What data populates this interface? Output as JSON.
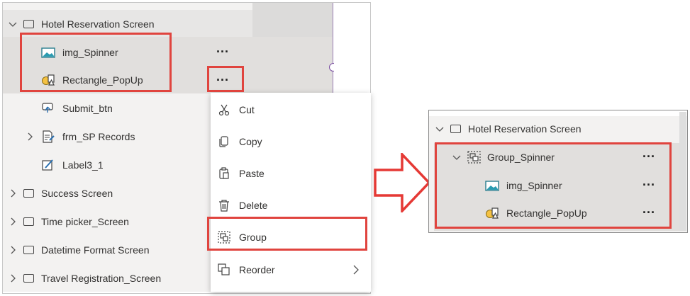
{
  "tree": {
    "screen_title": "Hotel Reservation Screen",
    "children": [
      "img_Spinner",
      "Rectangle_PopUp",
      "Submit_btn",
      "frm_SP Records",
      "Label3_1"
    ],
    "other_screens": [
      "Success Screen",
      "Time picker_Screen",
      "Datetime Format Screen",
      "Travel Registration_Screen"
    ],
    "more": "..."
  },
  "context_menu": {
    "items": [
      "Cut",
      "Copy",
      "Paste",
      "Delete",
      "Group",
      "Reorder"
    ]
  },
  "result": {
    "screen_title": "Hotel Reservation Screen",
    "group_name": "Group_Spinner",
    "children": [
      "img_Spinner",
      "Rectangle_PopUp"
    ],
    "more": "..."
  },
  "colors": {
    "highlight": "#e0443e",
    "arrow": "#e53935",
    "panel_bg": "#f3f2f1",
    "selected_bg": "#e1dfdd"
  },
  "icons": {
    "expand": "chevron-down-icon",
    "collapse": "chevron-right-icon",
    "screen": "screen-icon",
    "image": "image-icon",
    "shape": "shapes-icon",
    "button": "button-icon",
    "form": "form-icon",
    "label": "label-icon",
    "group": "group-icon",
    "more": "more-icon"
  }
}
